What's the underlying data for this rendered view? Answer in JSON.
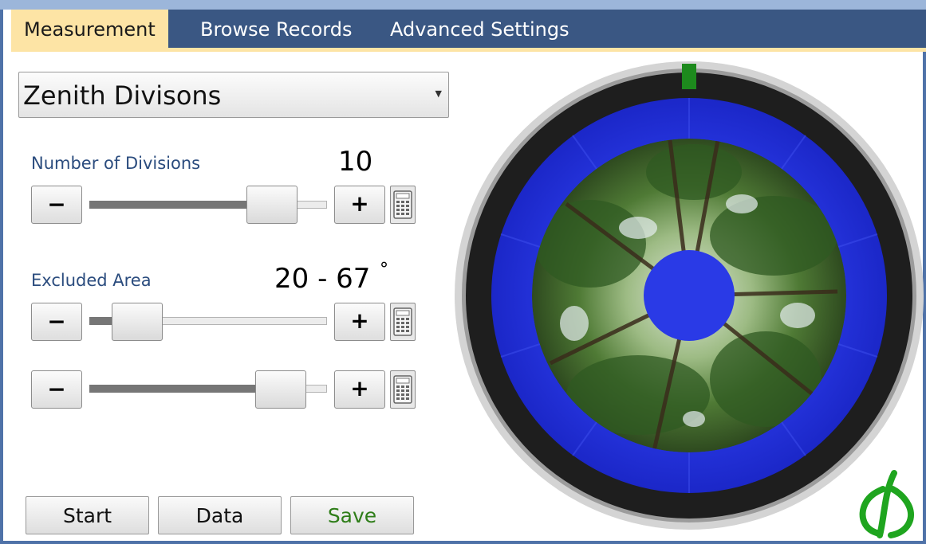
{
  "tabs": [
    {
      "label": "Measurement",
      "active": true
    },
    {
      "label": "Browse Records",
      "active": false
    },
    {
      "label": "Advanced Settings",
      "active": false
    }
  ],
  "mode_select": {
    "value": "Zenith Divisons"
  },
  "divisions": {
    "label": "Number of Divisions",
    "value": "10",
    "slider_fraction": 0.84
  },
  "excluded_area": {
    "label": "Excluded Area",
    "value": "20 - 67",
    "unit": "°",
    "lower_slider_fraction": 0.12,
    "upper_slider_fraction": 0.89
  },
  "stepper": {
    "minus": "−",
    "plus": "+"
  },
  "buttons": {
    "start": "Start",
    "data": "Data",
    "save": "Save"
  },
  "colors": {
    "tab_bar": "#3a5783",
    "active_tab": "#fde4a5",
    "overlay_blue": "#1f2ee0",
    "indicator_green": "#1d8a1d",
    "logo_green": "#1fa51f"
  },
  "icons": [
    "chevron-down-icon",
    "calculator-icon",
    "leaf-logo-icon"
  ]
}
